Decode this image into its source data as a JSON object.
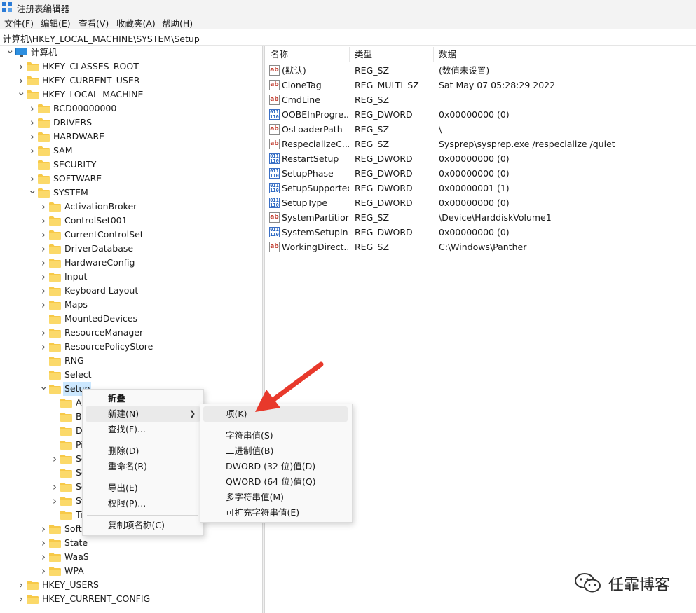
{
  "window": {
    "title": "注册表编辑器"
  },
  "menu": [
    "文件(F)",
    "编辑(E)",
    "查看(V)",
    "收藏夹(A)",
    "帮助(H)"
  ],
  "address": "计算机\\HKEY_LOCAL_MACHINE\\SYSTEM\\Setup",
  "tree": {
    "root": "计算机",
    "hives": [
      "HKEY_CLASSES_ROOT",
      "HKEY_CURRENT_USER",
      "HKEY_LOCAL_MACHINE"
    ],
    "hklm_children": [
      "BCD00000000",
      "DRIVERS",
      "HARDWARE",
      "SAM",
      "SECURITY",
      "SOFTWARE",
      "SYSTEM"
    ],
    "system_children": [
      "ActivationBroker",
      "ControlSet001",
      "CurrentControlSet",
      "DriverDatabase",
      "HardwareConfig",
      "Input",
      "Keyboard Layout",
      "Maps",
      "MountedDevices",
      "ResourceManager",
      "ResourcePolicyStore",
      "RNG",
      "Select",
      "Setup"
    ],
    "setup_children_partial": [
      "Al",
      "Bu",
      "D",
      "Pi",
      "Se",
      "Se",
      "Se",
      "St",
      "Ti"
    ],
    "after_setup": [
      "Softw",
      "State",
      "WaaS",
      "WPA"
    ],
    "bottom_hives": [
      "HKEY_USERS",
      "HKEY_CURRENT_CONFIG"
    ]
  },
  "list": {
    "columns": [
      "名称",
      "类型",
      "数据"
    ],
    "rows": [
      {
        "name": "(默认)",
        "type": "REG_SZ",
        "data": "(数值未设置)",
        "icon": "string-value-icon"
      },
      {
        "name": "CloneTag",
        "type": "REG_MULTI_SZ",
        "data": "Sat May 07 05:28:29 2022",
        "icon": "string-value-icon"
      },
      {
        "name": "CmdLine",
        "type": "REG_SZ",
        "data": "",
        "icon": "string-value-icon"
      },
      {
        "name": "OOBEInProgre...",
        "type": "REG_DWORD",
        "data": "0x00000000 (0)",
        "icon": "binary-value-icon"
      },
      {
        "name": "OsLoaderPath",
        "type": "REG_SZ",
        "data": "\\",
        "icon": "string-value-icon"
      },
      {
        "name": "RespecializeC...",
        "type": "REG_SZ",
        "data": "Sysprep\\sysprep.exe /respecialize /quiet",
        "icon": "string-value-icon"
      },
      {
        "name": "RestartSetup",
        "type": "REG_DWORD",
        "data": "0x00000000 (0)",
        "icon": "binary-value-icon"
      },
      {
        "name": "SetupPhase",
        "type": "REG_DWORD",
        "data": "0x00000000 (0)",
        "icon": "binary-value-icon"
      },
      {
        "name": "SetupSupported",
        "type": "REG_DWORD",
        "data": "0x00000001 (1)",
        "icon": "binary-value-icon"
      },
      {
        "name": "SetupType",
        "type": "REG_DWORD",
        "data": "0x00000000 (0)",
        "icon": "binary-value-icon"
      },
      {
        "name": "SystemPartition",
        "type": "REG_SZ",
        "data": "\\Device\\HarddiskVolume1",
        "icon": "string-value-icon"
      },
      {
        "name": "SystemSetupIn...",
        "type": "REG_DWORD",
        "data": "0x00000000 (0)",
        "icon": "binary-value-icon"
      },
      {
        "name": "WorkingDirect...",
        "type": "REG_SZ",
        "data": "C:\\Windows\\Panther",
        "icon": "string-value-icon"
      }
    ]
  },
  "context_menu": {
    "items": [
      "折叠",
      "新建(N)",
      "查找(F)...",
      "删除(D)",
      "重命名(R)",
      "导出(E)",
      "权限(P)...",
      "复制项名称(C)"
    ]
  },
  "submenu": {
    "items": [
      "项(K)",
      "字符串值(S)",
      "二进制值(B)",
      "DWORD (32 位)值(D)",
      "QWORD (64 位)值(Q)",
      "多字符串值(M)",
      "可扩充字符串值(E)"
    ]
  },
  "watermark": "任霏博客",
  "colors": {
    "selection": "#cce8ff",
    "arrow": "#e8392b",
    "folder": "#f7c948"
  }
}
